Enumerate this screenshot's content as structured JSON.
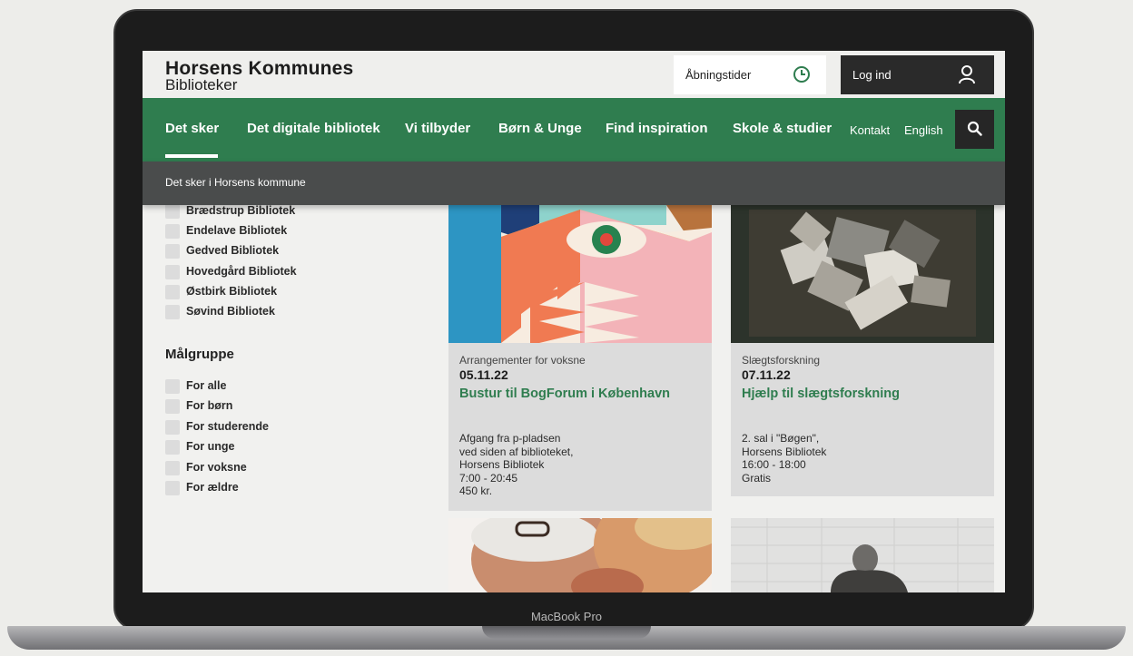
{
  "device": {
    "label": "MacBook Pro"
  },
  "header": {
    "logo_line1": "Horsens Kommunes",
    "logo_line2": "Biblioteker",
    "hours_label": "Åbningstider",
    "login_label": "Log ind"
  },
  "nav": {
    "items": [
      "Det sker",
      "Det digitale bibliotek",
      "Vi tilbyder",
      "Børn & Unge",
      "Find inspiration",
      "Skole & studier"
    ],
    "contact": "Kontakt",
    "english": "English"
  },
  "breadcrumb": "Det sker i Horsens kommune",
  "filters": {
    "libraries": [
      "Brædstrup Bibliotek",
      "Endelave Bibliotek",
      "Gedved Bibliotek",
      "Hovedgård Bibliotek",
      "Østbirk Bibliotek",
      "Søvind Bibliotek"
    ],
    "audience_title": "Målgruppe",
    "audience": [
      "For alle",
      "For børn",
      "For studerende",
      "For unge",
      "For voksne",
      "For ældre"
    ]
  },
  "events": [
    {
      "category": "Arrangementer for voksne",
      "date": "05.11.22",
      "title": "Bustur til BogForum i København",
      "info": [
        "Afgang fra p-pladsen",
        "ved siden af biblioteket,",
        "Horsens Bibliotek",
        "7:00 - 20:45",
        "450 kr."
      ]
    },
    {
      "category": "Slægtsforskning",
      "date": "07.11.22",
      "title": "Hjælp til slægtsforskning",
      "info": [
        "2. sal i \"Bøgen\",",
        "Horsens Bibliotek",
        "16:00 - 18:00",
        "Gratis"
      ]
    }
  ],
  "colors": {
    "brand_green": "#2f7d4f",
    "dark": "#262626",
    "breadcrumb_bg": "#4a4c4c"
  }
}
